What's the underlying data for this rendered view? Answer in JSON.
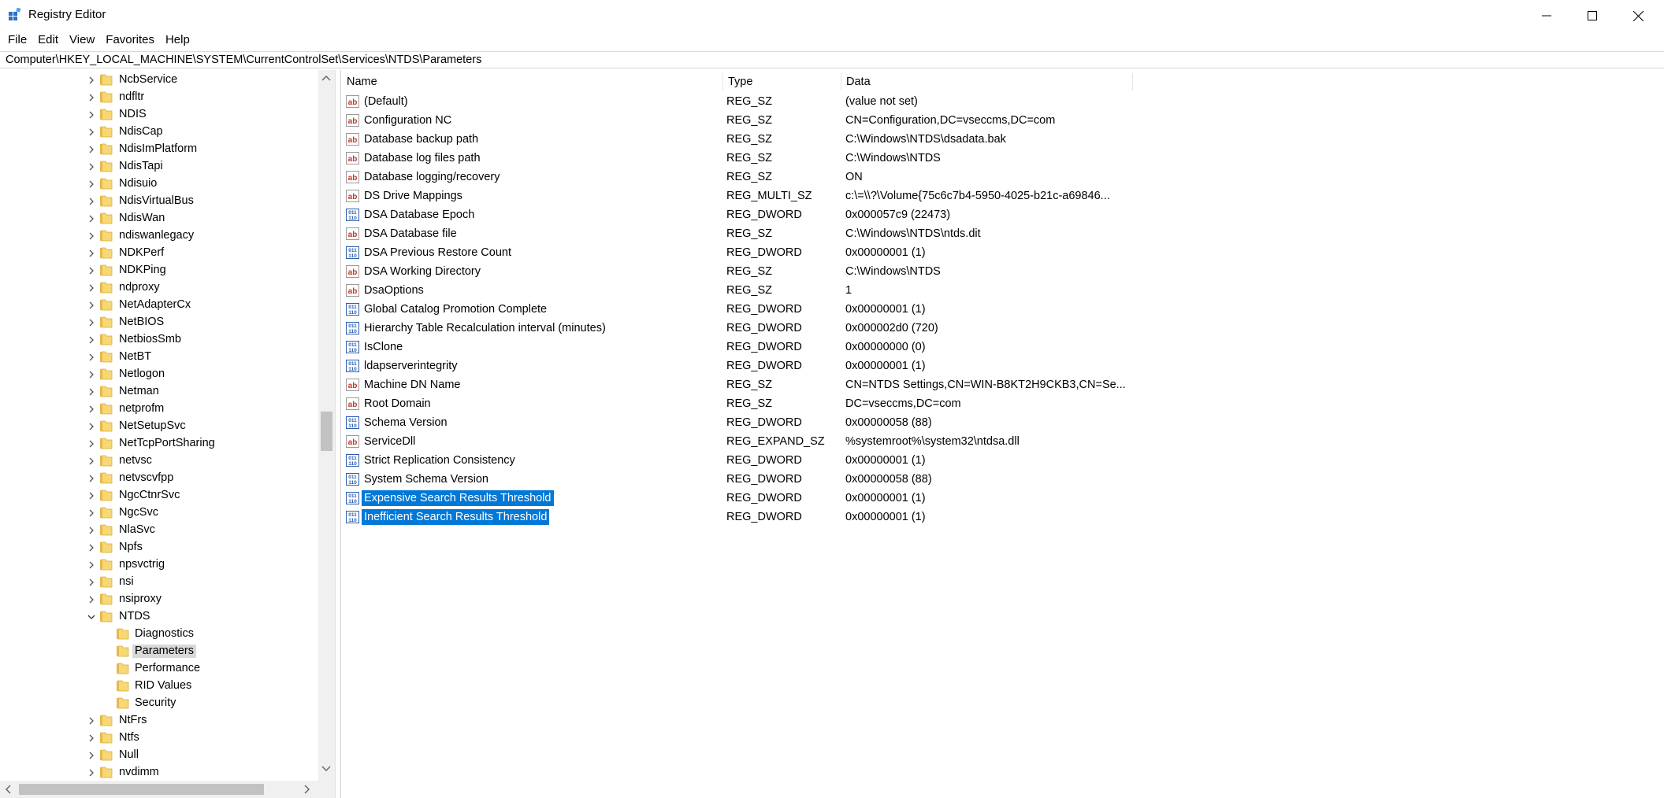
{
  "window": {
    "title": "Registry Editor"
  },
  "menu": [
    "File",
    "Edit",
    "View",
    "Favorites",
    "Help"
  ],
  "address": "Computer\\HKEY_LOCAL_MACHINE\\SYSTEM\\CurrentControlSet\\Services\\NTDS\\Parameters",
  "tree": {
    "items": [
      {
        "label": "NcbService",
        "level": 1,
        "state": "collapsed"
      },
      {
        "label": "ndfltr",
        "level": 1,
        "state": "collapsed"
      },
      {
        "label": "NDIS",
        "level": 1,
        "state": "collapsed"
      },
      {
        "label": "NdisCap",
        "level": 1,
        "state": "collapsed"
      },
      {
        "label": "NdisImPlatform",
        "level": 1,
        "state": "collapsed"
      },
      {
        "label": "NdisTapi",
        "level": 1,
        "state": "collapsed"
      },
      {
        "label": "Ndisuio",
        "level": 1,
        "state": "collapsed"
      },
      {
        "label": "NdisVirtualBus",
        "level": 1,
        "state": "collapsed"
      },
      {
        "label": "NdisWan",
        "level": 1,
        "state": "collapsed"
      },
      {
        "label": "ndiswanlegacy",
        "level": 1,
        "state": "collapsed"
      },
      {
        "label": "NDKPerf",
        "level": 1,
        "state": "collapsed"
      },
      {
        "label": "NDKPing",
        "level": 1,
        "state": "collapsed"
      },
      {
        "label": "ndproxy",
        "level": 1,
        "state": "collapsed"
      },
      {
        "label": "NetAdapterCx",
        "level": 1,
        "state": "collapsed"
      },
      {
        "label": "NetBIOS",
        "level": 1,
        "state": "collapsed"
      },
      {
        "label": "NetbiosSmb",
        "level": 1,
        "state": "collapsed"
      },
      {
        "label": "NetBT",
        "level": 1,
        "state": "collapsed"
      },
      {
        "label": "Netlogon",
        "level": 1,
        "state": "collapsed"
      },
      {
        "label": "Netman",
        "level": 1,
        "state": "collapsed"
      },
      {
        "label": "netprofm",
        "level": 1,
        "state": "collapsed"
      },
      {
        "label": "NetSetupSvc",
        "level": 1,
        "state": "collapsed"
      },
      {
        "label": "NetTcpPortSharing",
        "level": 1,
        "state": "collapsed"
      },
      {
        "label": "netvsc",
        "level": 1,
        "state": "collapsed"
      },
      {
        "label": "netvscvfpp",
        "level": 1,
        "state": "collapsed"
      },
      {
        "label": "NgcCtnrSvc",
        "level": 1,
        "state": "collapsed"
      },
      {
        "label": "NgcSvc",
        "level": 1,
        "state": "collapsed"
      },
      {
        "label": "NlaSvc",
        "level": 1,
        "state": "collapsed"
      },
      {
        "label": "Npfs",
        "level": 1,
        "state": "collapsed"
      },
      {
        "label": "npsvctrig",
        "level": 1,
        "state": "collapsed"
      },
      {
        "label": "nsi",
        "level": 1,
        "state": "collapsed"
      },
      {
        "label": "nsiproxy",
        "level": 1,
        "state": "collapsed"
      },
      {
        "label": "NTDS",
        "level": 1,
        "state": "expanded"
      },
      {
        "label": "Diagnostics",
        "level": 2,
        "state": "leaf"
      },
      {
        "label": "Parameters",
        "level": 2,
        "state": "leaf",
        "selected": true
      },
      {
        "label": "Performance",
        "level": 2,
        "state": "leaf"
      },
      {
        "label": "RID Values",
        "level": 2,
        "state": "leaf"
      },
      {
        "label": "Security",
        "level": 2,
        "state": "leaf"
      },
      {
        "label": "NtFrs",
        "level": 1,
        "state": "collapsed"
      },
      {
        "label": "Ntfs",
        "level": 1,
        "state": "collapsed"
      },
      {
        "label": "Null",
        "level": 1,
        "state": "collapsed"
      },
      {
        "label": "nvdimm",
        "level": 1,
        "state": "collapsed"
      }
    ]
  },
  "columns": {
    "name": "Name",
    "type": "Type",
    "data": "Data"
  },
  "values": [
    {
      "icon": "string",
      "name": "(Default)",
      "type": "REG_SZ",
      "data": "(value not set)"
    },
    {
      "icon": "string",
      "name": "Configuration NC",
      "type": "REG_SZ",
      "data": "CN=Configuration,DC=vseccms,DC=com"
    },
    {
      "icon": "string",
      "name": "Database backup path",
      "type": "REG_SZ",
      "data": "C:\\Windows\\NTDS\\dsadata.bak"
    },
    {
      "icon": "string",
      "name": "Database log files path",
      "type": "REG_SZ",
      "data": "C:\\Windows\\NTDS"
    },
    {
      "icon": "string",
      "name": "Database logging/recovery",
      "type": "REG_SZ",
      "data": "ON"
    },
    {
      "icon": "string",
      "name": "DS Drive Mappings",
      "type": "REG_MULTI_SZ",
      "data": "c:\\=\\\\?\\Volume{75c6c7b4-5950-4025-b21c-a69846..."
    },
    {
      "icon": "binary",
      "name": "DSA Database Epoch",
      "type": "REG_DWORD",
      "data": "0x000057c9 (22473)"
    },
    {
      "icon": "string",
      "name": "DSA Database file",
      "type": "REG_SZ",
      "data": "C:\\Windows\\NTDS\\ntds.dit"
    },
    {
      "icon": "binary",
      "name": "DSA Previous Restore Count",
      "type": "REG_DWORD",
      "data": "0x00000001 (1)"
    },
    {
      "icon": "string",
      "name": "DSA Working Directory",
      "type": "REG_SZ",
      "data": "C:\\Windows\\NTDS"
    },
    {
      "icon": "string",
      "name": "DsaOptions",
      "type": "REG_SZ",
      "data": "1"
    },
    {
      "icon": "binary",
      "name": "Global Catalog Promotion Complete",
      "type": "REG_DWORD",
      "data": "0x00000001 (1)"
    },
    {
      "icon": "binary",
      "name": "Hierarchy Table Recalculation interval (minutes)",
      "type": "REG_DWORD",
      "data": "0x000002d0 (720)"
    },
    {
      "icon": "binary",
      "name": "IsClone",
      "type": "REG_DWORD",
      "data": "0x00000000 (0)"
    },
    {
      "icon": "binary",
      "name": "ldapserverintegrity",
      "type": "REG_DWORD",
      "data": "0x00000001 (1)"
    },
    {
      "icon": "string",
      "name": "Machine DN Name",
      "type": "REG_SZ",
      "data": "CN=NTDS Settings,CN=WIN-B8KT2H9CKB3,CN=Se..."
    },
    {
      "icon": "string",
      "name": "Root Domain",
      "type": "REG_SZ",
      "data": "DC=vseccms,DC=com"
    },
    {
      "icon": "binary",
      "name": "Schema Version",
      "type": "REG_DWORD",
      "data": "0x00000058 (88)"
    },
    {
      "icon": "string",
      "name": "ServiceDll",
      "type": "REG_EXPAND_SZ",
      "data": "%systemroot%\\system32\\ntdsa.dll"
    },
    {
      "icon": "binary",
      "name": "Strict Replication Consistency",
      "type": "REG_DWORD",
      "data": "0x00000001 (1)"
    },
    {
      "icon": "binary",
      "name": "System Schema Version",
      "type": "REG_DWORD",
      "data": "0x00000058 (88)"
    },
    {
      "icon": "binary",
      "name": "Expensive Search Results Threshold",
      "type": "REG_DWORD",
      "data": "0x00000001 (1)",
      "selected": true
    },
    {
      "icon": "binary",
      "name": "Inefficient Search Results Threshold",
      "type": "REG_DWORD",
      "data": "0x00000001 (1)",
      "selected": true
    }
  ],
  "colors": {
    "selection": "#0078d7",
    "tree_selection": "#d9d9d9",
    "folder": "#f8d775",
    "string_icon": "#c0392b",
    "binary_icon": "#2a5db0"
  }
}
